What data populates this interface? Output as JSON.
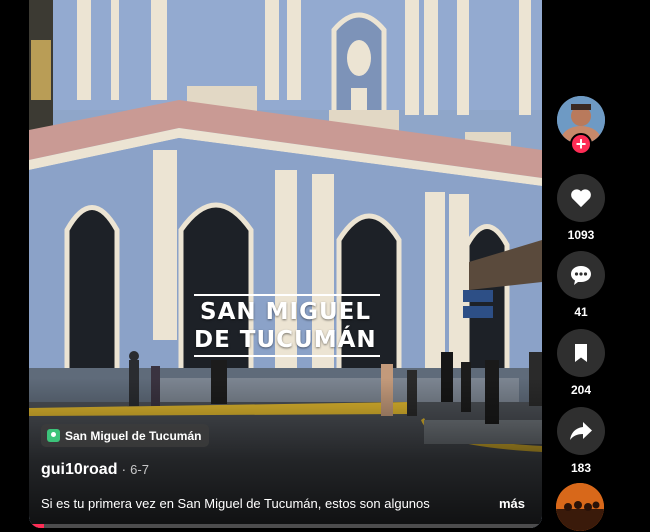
{
  "video": {
    "overlay_title_line1": "SAN MIGUEL",
    "overlay_title_line2": "DE TUCUMÁN",
    "location": "San Miguel de Tucumán",
    "author": "gui10road",
    "separator": "·",
    "date": "6-7",
    "caption": "Si es tu primera vez en San Miguel de Tucumán, estos son algunos",
    "more_label": "más",
    "progress_fraction": 0.03
  },
  "actions": {
    "likes": "1093",
    "comments": "41",
    "saves": "204",
    "shares": "183"
  },
  "profile": {
    "follow_symbol": "+"
  },
  "colors": {
    "accent": "#fe2c55",
    "location_icon": "#3cc37a",
    "rail_button": "#2f2f2f",
    "facade_blue": "#8fa6c9",
    "trim_cream": "#ece4d3",
    "cornice_rose": "#c99a94"
  },
  "icons": {
    "like": "heart-icon",
    "comment": "comment-icon",
    "save": "bookmark-icon",
    "share": "share-arrow-icon",
    "location": "location-pin-icon"
  }
}
